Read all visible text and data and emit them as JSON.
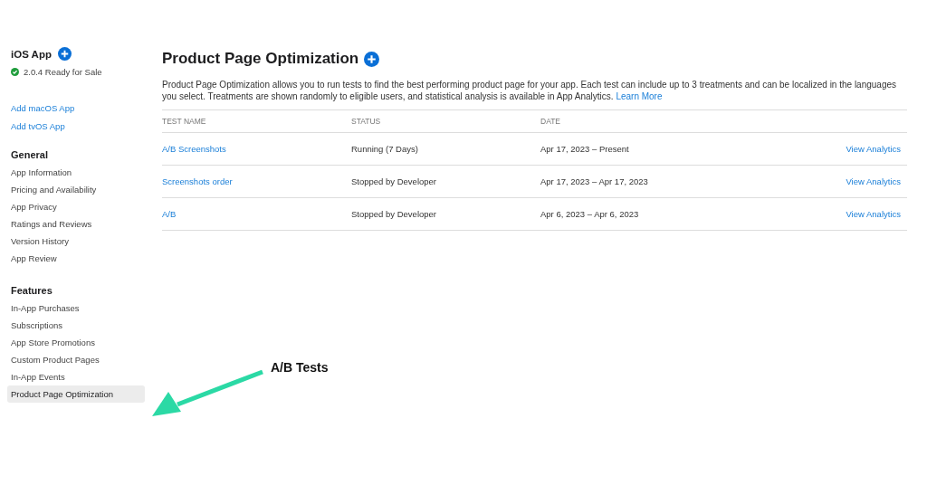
{
  "sidebar": {
    "app": {
      "title": "iOS App",
      "status": "2.0.4 Ready for Sale"
    },
    "links": [
      "Add macOS App",
      "Add tvOS App"
    ],
    "sections": [
      {
        "heading": "General",
        "items": [
          {
            "label": "App Information",
            "selected": false
          },
          {
            "label": "Pricing and Availability",
            "selected": false
          },
          {
            "label": "App Privacy",
            "selected": false
          },
          {
            "label": "Ratings and Reviews",
            "selected": false
          },
          {
            "label": "Version History",
            "selected": false
          },
          {
            "label": "App Review",
            "selected": false
          }
        ]
      },
      {
        "heading": "Features",
        "items": [
          {
            "label": "In-App Purchases",
            "selected": false
          },
          {
            "label": "Subscriptions",
            "selected": false
          },
          {
            "label": "App Store Promotions",
            "selected": false
          },
          {
            "label": "Custom Product Pages",
            "selected": false
          },
          {
            "label": "In-App Events",
            "selected": false
          },
          {
            "label": "Product Page Optimization",
            "selected": true
          }
        ]
      }
    ]
  },
  "main": {
    "title": "Product Page Optimization",
    "description": "Product Page Optimization allows you to run tests to find the best performing product page for your app. Each test can include up to 3 treatments and can be localized in the languages you select. Treatments are shown randomly to eligible users, and statistical analysis is available in App Analytics.",
    "learn_more": "Learn More",
    "table": {
      "columns": [
        "TEST NAME",
        "STATUS",
        "DATE"
      ],
      "rows": [
        {
          "name": "A/B Screenshots",
          "status": "Running (7 Days)",
          "date": "Apr 17, 2023 – Present",
          "action": "View Analytics"
        },
        {
          "name": "Screenshots order",
          "status": "Stopped by Developer",
          "date": "Apr 17, 2023 – Apr 17, 2023",
          "action": "View Analytics"
        },
        {
          "name": "A/B",
          "status": "Stopped by Developer",
          "date": "Apr 6, 2023 – Apr 6, 2023",
          "action": "View Analytics"
        }
      ]
    }
  },
  "annotation": {
    "label": "A/B Tests"
  }
}
